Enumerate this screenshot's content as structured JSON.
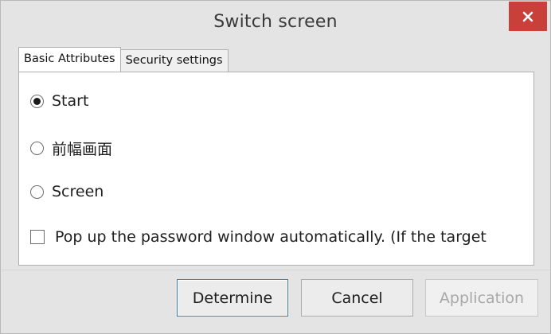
{
  "window": {
    "title": "Switch screen"
  },
  "tabs": [
    {
      "label": "Basic Attributes",
      "active": true
    },
    {
      "label": "Security settings",
      "active": false
    }
  ],
  "options": {
    "start_label": "Start",
    "prev_label": "前幅画面",
    "screen_label": "Screen",
    "selected": "Start"
  },
  "checkbox": {
    "label": "Pop up the password window automatically. (If the target",
    "checked": false
  },
  "buttons": {
    "determine": "Determine",
    "cancel": "Cancel",
    "application": "Application"
  },
  "colors": {
    "close_button": "#c9403b",
    "default_button_border": "#3c7fb1",
    "window_background": "#e4e4e4"
  },
  "icons": {
    "close": "close-icon"
  }
}
